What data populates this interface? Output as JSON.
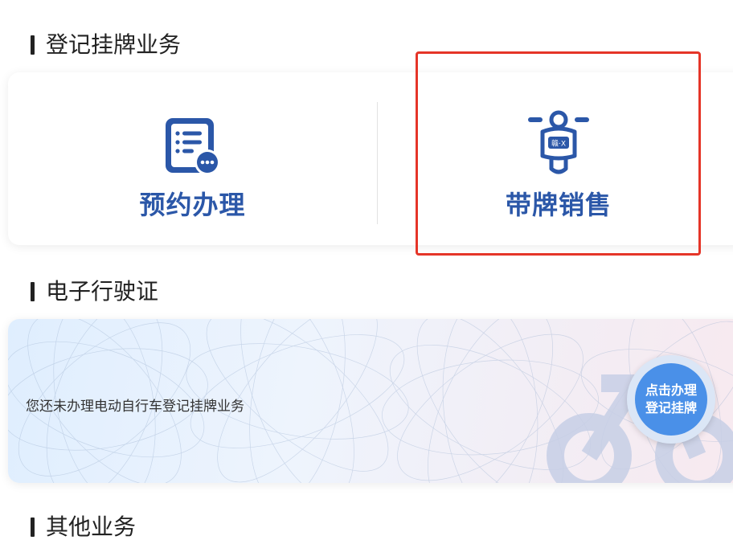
{
  "sections": {
    "registration": {
      "title": "登记挂牌业务",
      "services": [
        {
          "label": "预约办理",
          "icon": "document-list-icon"
        },
        {
          "label": "带牌销售",
          "icon": "scooter-plate-icon",
          "plate_text": "赣·X"
        }
      ]
    },
    "license": {
      "title": "电子行驶证",
      "status_text": "您还未办理电动自行车登记挂牌业务",
      "action_line1": "点击办理",
      "action_line2": "登记挂牌"
    },
    "other": {
      "title": "其他业务"
    }
  },
  "colors": {
    "brand_blue": "#2b57a8",
    "action_blue": "#4a90e8",
    "highlight_red": "#e53528"
  }
}
